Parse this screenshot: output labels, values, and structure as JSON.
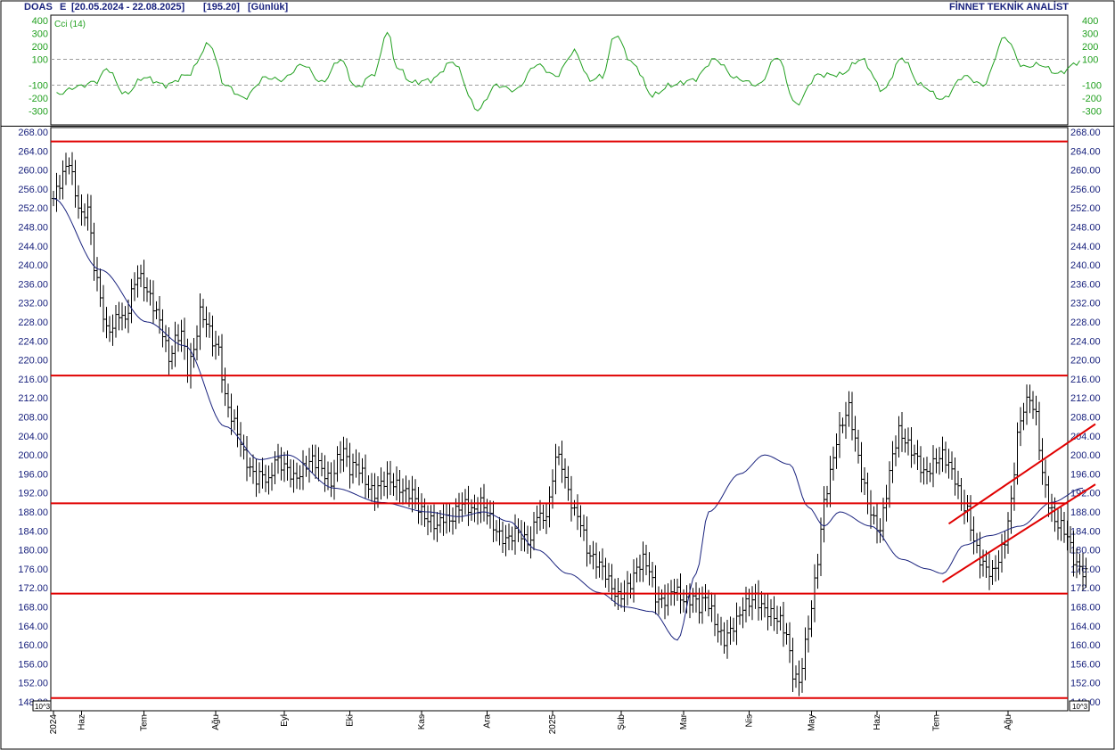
{
  "header": {
    "symbol": "DOAS",
    "flag": "E",
    "range": "[20.05.2024 - 22.08.2025]",
    "last": "[195.20]",
    "period": "[Günlük]",
    "brand": "FİNNET TEKNİK ANALİST"
  },
  "colors": {
    "axis_text": "#1a237e",
    "price_bars": "#000000",
    "moving_average": "#1a237e",
    "levels": "#e00000",
    "cci": "#22a020",
    "border": "#000000"
  },
  "chart_data": [
    {
      "type": "line",
      "title": "",
      "series_label": "Cci (14)",
      "y_ticks": [
        "400",
        "300",
        "200",
        "100",
        "-100",
        "-200",
        "-300"
      ],
      "y_reference_lines": [
        100,
        -100
      ],
      "ylim": [
        -400,
        400
      ],
      "grid": false,
      "x_index": [
        1,
        8,
        14,
        17,
        23,
        29,
        36,
        43,
        50,
        55,
        61,
        68,
        73,
        80,
        86,
        92,
        97,
        103,
        107,
        110,
        115,
        121,
        128,
        136,
        142,
        148,
        155,
        161,
        167,
        172,
        176,
        180,
        186,
        192,
        198,
        205,
        212,
        219,
        226,
        232,
        238,
        245,
        252,
        259,
        266,
        272,
        278,
        285,
        292,
        298,
        305,
        311,
        316,
        322,
        329
      ],
      "values": [
        -170,
        -110,
        -70,
        30,
        -170,
        -40,
        -100,
        -20,
        220,
        -100,
        -200,
        -40,
        -60,
        60,
        -80,
        100,
        -120,
        -10,
        320,
        40,
        -80,
        -60,
        80,
        -290,
        -100,
        -140,
        60,
        -30,
        160,
        -60,
        -30,
        290,
        60,
        -180,
        -100,
        -60,
        100,
        -50,
        -100,
        120,
        -250,
        -20,
        -20,
        100,
        -140,
        110,
        -100,
        -210,
        -30,
        -100,
        270,
        40,
        60,
        -10,
        80
      ]
    },
    {
      "type": "ohlc",
      "title": "",
      "y_ticks": [
        "268.00",
        "264.00",
        "260.00",
        "256.00",
        "252.00",
        "248.00",
        "244.00",
        "240.00",
        "236.00",
        "232.00",
        "228.00",
        "224.00",
        "220.00",
        "216.00",
        "212.00",
        "208.00",
        "204.00",
        "200.00",
        "196.00",
        "192.00",
        "188.00",
        "184.00",
        "180.00",
        "176.00",
        "172.00",
        "168.00",
        "164.00",
        "160.00",
        "156.00",
        "152.00",
        "148.00"
      ],
      "ylim": [
        147.5,
        268.5
      ],
      "grid": false,
      "x_ticks": [
        {
          "label": "2024",
          "index": 0
        },
        {
          "label": "Haz",
          "index": 9
        },
        {
          "label": "Tem",
          "index": 29
        },
        {
          "label": "Ağu",
          "index": 52
        },
        {
          "label": "Eyl",
          "index": 74
        },
        {
          "label": "Eki",
          "index": 95
        },
        {
          "label": "Kas",
          "index": 118
        },
        {
          "label": "Ara",
          "index": 139
        },
        {
          "label": "2025",
          "index": 160
        },
        {
          "label": "Şub",
          "index": 182
        },
        {
          "label": "Mar",
          "index": 202
        },
        {
          "label": "Nis",
          "index": 223
        },
        {
          "label": "May",
          "index": 243
        },
        {
          "label": "Haz",
          "index": 264
        },
        {
          "label": "Tem",
          "index": 283
        },
        {
          "label": "Ağu",
          "index": 306
        }
      ],
      "scale_note": "10^3",
      "horizontal_levels": [
        266,
        216.7,
        189.8,
        170.8,
        148.8
      ],
      "channel_lines": [
        {
          "from": {
            "index": 287,
            "value": 185.5
          },
          "to": {
            "index": 334,
            "value": 206.5
          }
        },
        {
          "from": {
            "index": 285,
            "value": 173.2
          },
          "to": {
            "index": 334,
            "value": 193.8
          }
        }
      ],
      "close_anchors": {
        "index": [
          0,
          3,
          5,
          7,
          9,
          11,
          13,
          15,
          17,
          19,
          21,
          23,
          25,
          27,
          29,
          31,
          33,
          35,
          37,
          39,
          41,
          43,
          45,
          47,
          49,
          51,
          53,
          55,
          57,
          59,
          61,
          63,
          65,
          67,
          69,
          71,
          73,
          75,
          77,
          79,
          81,
          83,
          85,
          87,
          89,
          91,
          93,
          95,
          97,
          99,
          101,
          103,
          105,
          107,
          109,
          111,
          113,
          115,
          117,
          119,
          121,
          123,
          125,
          127,
          129,
          131,
          133,
          135,
          137,
          139,
          141,
          143,
          145,
          147,
          149,
          151,
          153,
          155,
          157,
          159,
          161,
          163,
          165,
          167,
          169,
          171,
          173,
          175,
          177,
          179,
          181,
          183,
          185,
          187,
          189,
          191,
          193,
          195,
          197,
          199,
          201,
          203,
          205,
          207,
          209,
          211,
          213,
          215,
          217,
          219,
          221,
          223,
          225,
          227,
          229,
          231,
          233,
          235,
          237,
          239,
          241,
          243,
          245,
          247,
          249,
          251,
          253,
          255,
          257,
          259,
          261,
          263,
          265,
          267,
          269,
          271,
          273,
          275,
          277,
          279,
          281,
          283,
          285,
          287,
          289,
          291,
          293,
          295,
          297,
          299,
          301,
          303,
          305,
          307,
          309,
          311,
          313,
          315,
          317,
          319,
          321,
          323,
          325,
          327,
          329,
          331
        ],
        "values": [
          254,
          259,
          262,
          255,
          250,
          252,
          240,
          233,
          226,
          227,
          230,
          228,
          234,
          238,
          236,
          233,
          230,
          226,
          220,
          224,
          226,
          218,
          222,
          230,
          228,
          224,
          222,
          212,
          208,
          205,
          200,
          197,
          195,
          196,
          194,
          199,
          198,
          197,
          195,
          196,
          198,
          199,
          198,
          196,
          194,
          199,
          201,
          197,
          198,
          196,
          193,
          192,
          194,
          195,
          194,
          193,
          192,
          192,
          189,
          187,
          186,
          185,
          187,
          186,
          188,
          190,
          189,
          188,
          190,
          188,
          185,
          183,
          182,
          183,
          184,
          182,
          182,
          188,
          186,
          190,
          200,
          198,
          192,
          188,
          186,
          180,
          178,
          177,
          175,
          172,
          170,
          171,
          173,
          176,
          178,
          176,
          170,
          169,
          170,
          172,
          170,
          169,
          170,
          168,
          170,
          167,
          163,
          161,
          163,
          165,
          168,
          169,
          170,
          168,
          167,
          166,
          165,
          162,
          154,
          152,
          160,
          168,
          178,
          190,
          196,
          203,
          207,
          210,
          203,
          196,
          190,
          186,
          184,
          192,
          200,
          205,
          203,
          201,
          199,
          196,
          197,
          199,
          200,
          198,
          195,
          190,
          188,
          182,
          178,
          176,
          175,
          178,
          182,
          190,
          204,
          210,
          212,
          208,
          196,
          190,
          186,
          185,
          183,
          178,
          176,
          175,
          174,
          172,
          171,
          168,
          170,
          174,
          178,
          180,
          178,
          174,
          172,
          169,
          167,
          166,
          167,
          170,
          172,
          173,
          176,
          174,
          172,
          170,
          168,
          166,
          165,
          166,
          168,
          169,
          171,
          174,
          176,
          178,
          182,
          186,
          188,
          186,
          184,
          185,
          187,
          188,
          189,
          190,
          188,
          186,
          185,
          184,
          184,
          183,
          184,
          185,
          186,
          188,
          190,
          192,
          193,
          195,
          196,
          197,
          198,
          199,
          199,
          196,
          195,
          195
        ]
      },
      "moving_average_anchors": {
        "index": [
          0,
          15,
          30,
          42,
          55,
          66,
          75,
          90,
          105,
          120,
          130,
          138,
          146,
          155,
          165,
          175,
          183,
          192,
          200,
          206,
          210,
          220,
          228,
          236,
          242,
          247,
          252,
          262,
          272,
          280,
          285,
          292,
          300,
          310,
          320,
          330
        ],
        "values": [
          254,
          239,
          228,
          223,
          206,
          199,
          200,
          193,
          190,
          188,
          187,
          188,
          186,
          180,
          175,
          171,
          168,
          167,
          161,
          175,
          188,
          196,
          200,
          198,
          189,
          185,
          188,
          185,
          178,
          176,
          175,
          181,
          183,
          185,
          190,
          193
        ]
      }
    }
  ]
}
